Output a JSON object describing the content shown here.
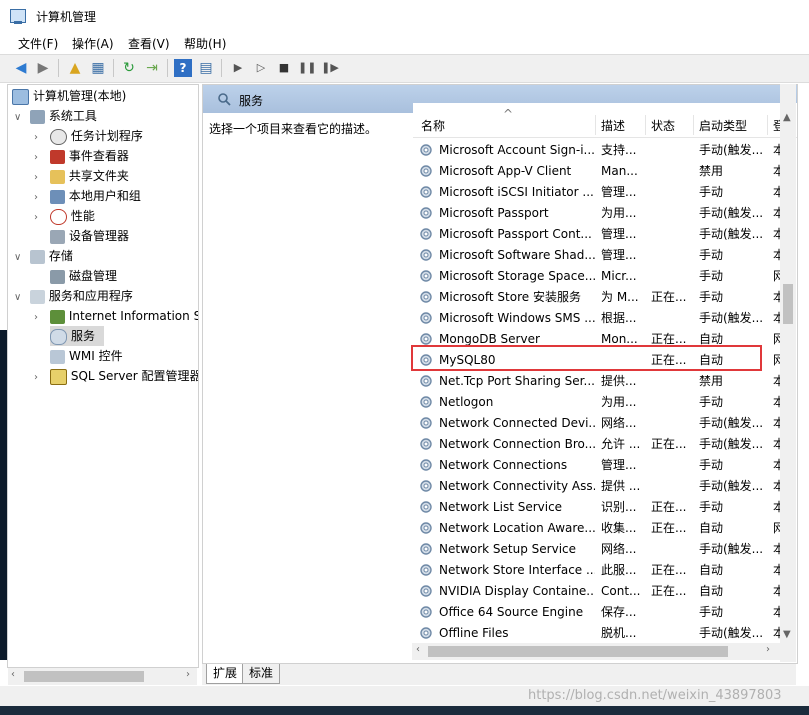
{
  "window": {
    "title": "计算机管理"
  },
  "menu": [
    "文件(F)",
    "操作(A)",
    "查看(V)",
    "帮助(H)"
  ],
  "toolbar": [
    "back-icon",
    "forward-icon",
    "up-folder-icon",
    "show-hide-tree-icon",
    "refresh-icon",
    "export-icon",
    "help-icon",
    "properties-icon",
    "play-icon",
    "play-alt-icon",
    "stop-icon",
    "pause-icon",
    "restart-icon"
  ],
  "tree": {
    "root": "计算机管理(本地)",
    "items": [
      {
        "label": "系统工具",
        "level": 0,
        "expanded": true
      },
      {
        "label": "任务计划程序",
        "level": 1,
        "expandable": true
      },
      {
        "label": "事件查看器",
        "level": 1,
        "expandable": true
      },
      {
        "label": "共享文件夹",
        "level": 1,
        "expandable": true
      },
      {
        "label": "本地用户和组",
        "level": 1,
        "expandable": true
      },
      {
        "label": "性能",
        "level": 1,
        "expandable": true
      },
      {
        "label": "设备管理器",
        "level": 1,
        "expandable": false
      },
      {
        "label": "存储",
        "level": 0,
        "expanded": true
      },
      {
        "label": "磁盘管理",
        "level": 1,
        "expandable": false
      },
      {
        "label": "服务和应用程序",
        "level": 0,
        "expanded": true
      },
      {
        "label": "Internet Information S",
        "level": 1,
        "expandable": true
      },
      {
        "label": "服务",
        "level": 1,
        "expandable": false,
        "selected": true
      },
      {
        "label": "WMI 控件",
        "level": 1,
        "expandable": false
      },
      {
        "label": "SQL Server 配置管理器",
        "level": 1,
        "expandable": true
      }
    ]
  },
  "services_panel": {
    "title": "服务",
    "description": "选择一个项目来查看它的描述。",
    "sort_indicator": "^",
    "columns": [
      "名称",
      "描述",
      "状态",
      "启动类型",
      "登"
    ],
    "rows": [
      {
        "name": "Microsoft Account Sign-i...",
        "desc": "支持...",
        "status": "",
        "startup": "手动(触发...",
        "logon": "本"
      },
      {
        "name": "Microsoft App-V Client",
        "desc": "Man...",
        "status": "",
        "startup": "禁用",
        "logon": "本"
      },
      {
        "name": "Microsoft iSCSI Initiator ...",
        "desc": "管理...",
        "status": "",
        "startup": "手动",
        "logon": "本"
      },
      {
        "name": "Microsoft Passport",
        "desc": "为用...",
        "status": "",
        "startup": "手动(触发...",
        "logon": "本"
      },
      {
        "name": "Microsoft Passport Cont...",
        "desc": "管理...",
        "status": "",
        "startup": "手动(触发...",
        "logon": "本"
      },
      {
        "name": "Microsoft Software Shad...",
        "desc": "管理...",
        "status": "",
        "startup": "手动",
        "logon": "本"
      },
      {
        "name": "Microsoft Storage Space...",
        "desc": "Micr...",
        "status": "",
        "startup": "手动",
        "logon": "网"
      },
      {
        "name": "Microsoft Store 安装服务",
        "desc": "为 M...",
        "status": "正在...",
        "startup": "手动",
        "logon": "本"
      },
      {
        "name": "Microsoft Windows SMS ...",
        "desc": "根据...",
        "status": "",
        "startup": "手动(触发...",
        "logon": "本"
      },
      {
        "name": "MongoDB Server",
        "desc": "Mon...",
        "status": "正在...",
        "startup": "自动",
        "logon": "网"
      },
      {
        "name": "MySQL80",
        "desc": "",
        "status": "正在...",
        "startup": "自动",
        "logon": "网"
      },
      {
        "name": "Net.Tcp Port Sharing Ser...",
        "desc": "提供...",
        "status": "",
        "startup": "禁用",
        "logon": "本"
      },
      {
        "name": "Netlogon",
        "desc": "为用...",
        "status": "",
        "startup": "手动",
        "logon": "本"
      },
      {
        "name": "Network Connected Devi...",
        "desc": "网络...",
        "status": "",
        "startup": "手动(触发...",
        "logon": "本"
      },
      {
        "name": "Network Connection Bro...",
        "desc": "允许 ...",
        "status": "正在...",
        "startup": "手动(触发...",
        "logon": "本"
      },
      {
        "name": "Network Connections",
        "desc": "管理...",
        "status": "",
        "startup": "手动",
        "logon": "本"
      },
      {
        "name": "Network Connectivity Ass...",
        "desc": "提供 ...",
        "status": "",
        "startup": "手动(触发...",
        "logon": "本"
      },
      {
        "name": "Network List Service",
        "desc": "识别...",
        "status": "正在...",
        "startup": "手动",
        "logon": "本"
      },
      {
        "name": "Network Location Aware...",
        "desc": "收集...",
        "status": "正在...",
        "startup": "自动",
        "logon": "网"
      },
      {
        "name": "Network Setup Service",
        "desc": "网络...",
        "status": "",
        "startup": "手动(触发...",
        "logon": "本"
      },
      {
        "name": "Network Store Interface ...",
        "desc": "此服...",
        "status": "正在...",
        "startup": "自动",
        "logon": "本"
      },
      {
        "name": "NVIDIA Display Containe...",
        "desc": "Cont...",
        "status": "正在...",
        "startup": "自动",
        "logon": "本"
      },
      {
        "name": "Office 64 Source Engine",
        "desc": "保存...",
        "status": "",
        "startup": "手动",
        "logon": "本"
      },
      {
        "name": "Offline Files",
        "desc": "脱机...",
        "status": "",
        "startup": "手动(触发...",
        "logon": "本"
      }
    ],
    "highlighted_row": "MySQL80"
  },
  "tabs": [
    "扩展",
    "标准"
  ],
  "watermark": "https://blog.csdn.net/weixin_43897803",
  "colors": {
    "highlight": "#e0383a",
    "header_bg": "#b3c9e4"
  }
}
